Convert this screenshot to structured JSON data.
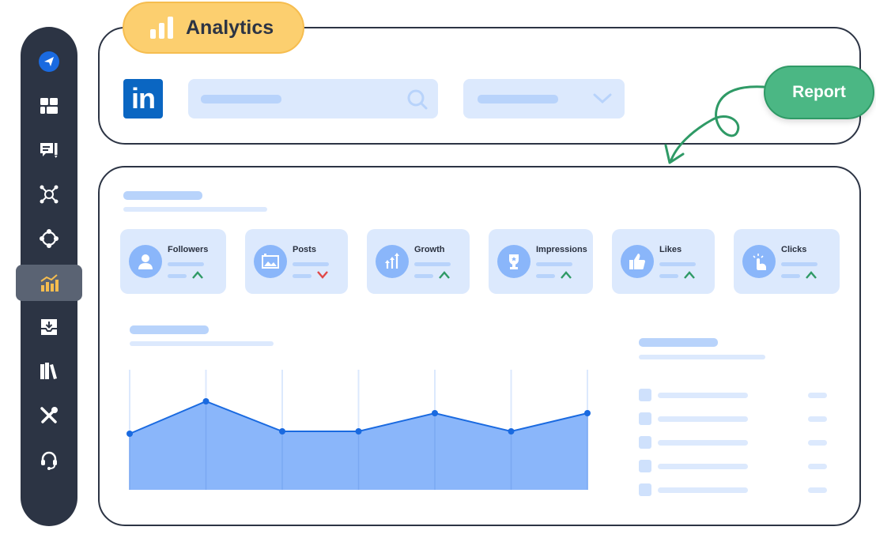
{
  "header": {
    "title": "Analytics",
    "report_label": "Report",
    "linkedin_logo": "in"
  },
  "search": {
    "icon": "search-icon"
  },
  "select": {
    "icon": "chevron-down-icon"
  },
  "sidebar": {
    "items": [
      {
        "icon": "paper-plane-icon"
      },
      {
        "icon": "dashboard-icon"
      },
      {
        "icon": "message-edit-icon"
      },
      {
        "icon": "network-icon"
      },
      {
        "icon": "cycle-icon"
      },
      {
        "icon": "analytics-icon",
        "active": true
      },
      {
        "icon": "inbox-download-icon"
      },
      {
        "icon": "library-icon"
      },
      {
        "icon": "tools-icon"
      },
      {
        "icon": "headset-icon"
      }
    ]
  },
  "metrics": [
    {
      "label": "Followers",
      "icon": "user-icon",
      "trend": "up"
    },
    {
      "label": "Posts",
      "icon": "image-icon",
      "trend": "down"
    },
    {
      "label": "Growth",
      "icon": "growth-arrows-icon",
      "trend": "up"
    },
    {
      "label": "Impressions",
      "icon": "trophy-icon",
      "trend": "up"
    },
    {
      "label": "Likes",
      "icon": "thumbs-up-icon",
      "trend": "up"
    },
    {
      "label": "Clicks",
      "icon": "tap-icon",
      "trend": "up"
    }
  ],
  "colors": {
    "accent": "#f6bd4f",
    "report": "#4bb784",
    "sidebar": "#2c3444",
    "area": "#8ab6fa",
    "line": "#1a6ae0",
    "up": "#2f9a66",
    "down": "#e04848"
  },
  "chart_data": {
    "type": "area",
    "x": [
      1,
      2,
      3,
      4,
      5,
      6,
      7
    ],
    "values": [
      71,
      112,
      74,
      74,
      97,
      74,
      97
    ],
    "ylim": [
      0,
      150
    ],
    "grid": "vertical"
  }
}
